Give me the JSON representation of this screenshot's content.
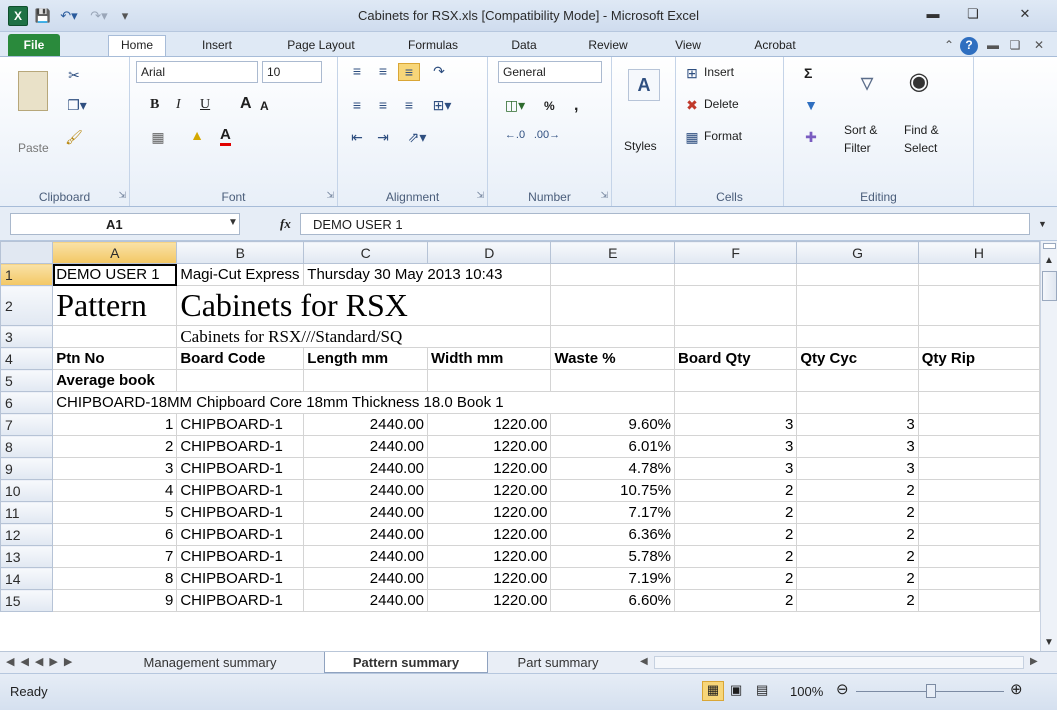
{
  "window": {
    "title": "Cabinets for RSX.xls  [Compatibility Mode]  -  Microsoft Excel",
    "app_icon": "X"
  },
  "tabs": [
    "File",
    "Home",
    "Insert",
    "Page Layout",
    "Formulas",
    "Data",
    "Review",
    "View",
    "Acrobat"
  ],
  "ribbon": {
    "clipboard": {
      "label": "Clipboard",
      "paste": "Paste"
    },
    "font": {
      "label": "Font",
      "name": "Arial",
      "size": "10",
      "bold": "B",
      "italic": "I",
      "underline": "U",
      "grow": "A",
      "shrink": "A",
      "color_a": "A"
    },
    "alignment": {
      "label": "Alignment"
    },
    "number": {
      "label": "Number",
      "format": "General",
      "percent": "%",
      "comma": ","
    },
    "styles": {
      "label": "Styles"
    },
    "cells": {
      "label": "Cells",
      "insert": "Insert",
      "delete": "Delete",
      "format": "Format"
    },
    "editing": {
      "label": "Editing",
      "sigma": "Σ",
      "sort": "Sort &",
      "filter": "Filter",
      "find": "Find &",
      "select": "Select"
    }
  },
  "formula_bar": {
    "name_box": "A1",
    "fx": "fx",
    "content": "DEMO USER 1"
  },
  "columns": [
    "A",
    "B",
    "C",
    "D",
    "E",
    "F",
    "G",
    "H"
  ],
  "rows": [
    {
      "n": "1",
      "cells": [
        "DEMO USER 1",
        "Magi-Cut Express",
        "Thursday 30 May 2013 10:43",
        "",
        "",
        "",
        "",
        ""
      ]
    },
    {
      "n": "2",
      "cells": [
        "Pattern",
        "Cabinets for RSX",
        "",
        "",
        "",
        "",
        "",
        ""
      ]
    },
    {
      "n": "3",
      "cells": [
        "",
        "Cabinets for RSX///Standard/SQ",
        "",
        "",
        "",
        "",
        "",
        ""
      ]
    },
    {
      "n": "4",
      "cells": [
        "Ptn No",
        "Board Code",
        "Length mm",
        "Width mm",
        "Waste %",
        "Board Qty",
        "Qty Cyc",
        "Qty Rip"
      ]
    },
    {
      "n": "5",
      "cells": [
        "Average book",
        "",
        "",
        "",
        "",
        "",
        "",
        ""
      ]
    },
    {
      "n": "6",
      "cells": [
        "CHIPBOARD-18MM Chipboard Core 18mm Thickness  18.0 Book 1",
        "",
        "",
        "",
        "",
        "",
        "",
        ""
      ]
    },
    {
      "n": "7",
      "cells": [
        "1",
        "CHIPBOARD-1",
        "2440.00",
        "1220.00",
        "9.60%",
        "3",
        "3",
        ""
      ]
    },
    {
      "n": "8",
      "cells": [
        "2",
        "CHIPBOARD-1",
        "2440.00",
        "1220.00",
        "6.01%",
        "3",
        "3",
        ""
      ]
    },
    {
      "n": "9",
      "cells": [
        "3",
        "CHIPBOARD-1",
        "2440.00",
        "1220.00",
        "4.78%",
        "3",
        "3",
        ""
      ]
    },
    {
      "n": "10",
      "cells": [
        "4",
        "CHIPBOARD-1",
        "2440.00",
        "1220.00",
        "10.75%",
        "2",
        "2",
        ""
      ]
    },
    {
      "n": "11",
      "cells": [
        "5",
        "CHIPBOARD-1",
        "2440.00",
        "1220.00",
        "7.17%",
        "2",
        "2",
        ""
      ]
    },
    {
      "n": "12",
      "cells": [
        "6",
        "CHIPBOARD-1",
        "2440.00",
        "1220.00",
        "6.36%",
        "2",
        "2",
        ""
      ]
    },
    {
      "n": "13",
      "cells": [
        "7",
        "CHIPBOARD-1",
        "2440.00",
        "1220.00",
        "5.78%",
        "2",
        "2",
        ""
      ]
    },
    {
      "n": "14",
      "cells": [
        "8",
        "CHIPBOARD-1",
        "2440.00",
        "1220.00",
        "7.19%",
        "2",
        "2",
        ""
      ]
    },
    {
      "n": "15",
      "cells": [
        "9",
        "CHIPBOARD-1",
        "2440.00",
        "1220.00",
        "6.60%",
        "2",
        "2",
        ""
      ]
    }
  ],
  "sheet_tabs": [
    "Management summary",
    "Pattern summary",
    "Part summary"
  ],
  "status": {
    "ready": "Ready",
    "zoom": "100%"
  }
}
